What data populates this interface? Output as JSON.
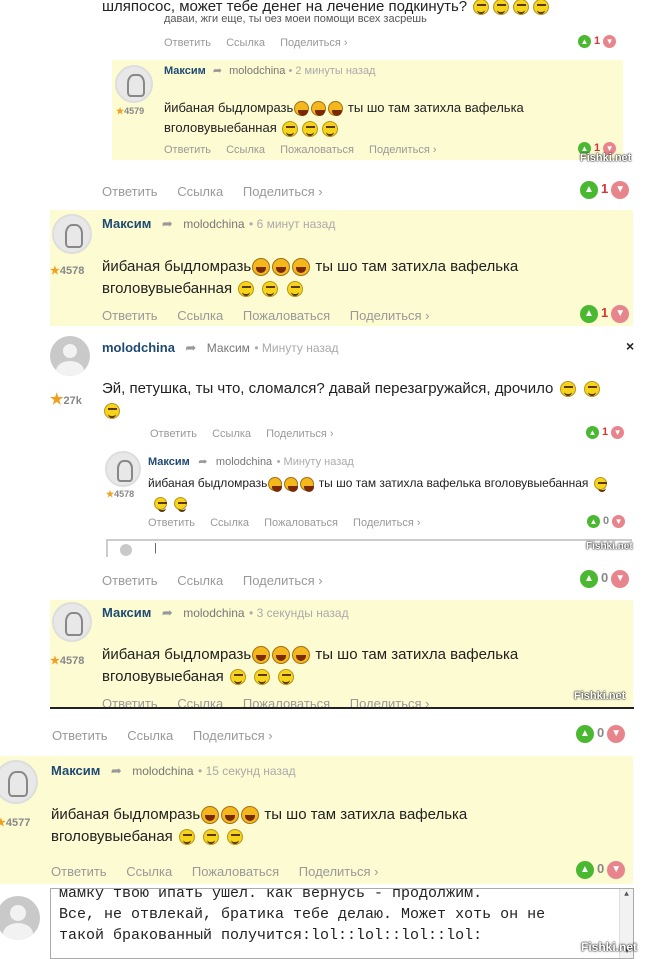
{
  "actions": {
    "reply": "Ответить",
    "link": "Ссылка",
    "share": "Поделиться ›",
    "complain": "Пожаловаться"
  },
  "watermark": "Fishki.net",
  "top": {
    "text_line1": "шляпосос, может тебе денег на лечение подкинуть?",
    "text_line2": "давай, жги ещё, ты без моей помощи всех засрёшь",
    "votes": "1"
  },
  "c1": {
    "author": "Максим",
    "reply_to": "molodchina",
    "time": "• 2 минуты назад",
    "rating": "4579",
    "text1": "йибаная быдломразь",
    "text2": "ты шо там затихла вафелька",
    "text3": "вголовувыебанная",
    "votes": "1"
  },
  "c1_outer_votes": "1",
  "c2": {
    "author": "Максим",
    "reply_to": "molodchina",
    "time": "• 6 минут назад",
    "rating": "4578",
    "text1": "йибаная быдломразь",
    "text2": "ты шо там затихла вафелька",
    "text3": "вголовувыебанная",
    "votes": "1"
  },
  "c3": {
    "author": "molodchina",
    "reply_to": "Максим",
    "time": "• Минуту назад",
    "rating": "27k",
    "text": "Эй, петушка, ты что, сломался? давай перезагружайся, дрочило",
    "votes": "1",
    "close": "×"
  },
  "c4": {
    "author": "Максим",
    "reply_to": "molodchina",
    "time": "• Минуту назад",
    "rating": "4578",
    "text1": "йибаная быдломразь",
    "text2": "ты шо там затихла вафелька вголовувыебанная",
    "votes": "0",
    "input_value": "|"
  },
  "c4_outer_votes": "0",
  "c5": {
    "author": "Максим",
    "reply_to": "molodchina",
    "time": "• 3 секунды назад",
    "rating": "4578",
    "text1": "йибаная быдломразь",
    "text2": "ты шо там затихла вафелька",
    "text3": "вголовувыебаная",
    "votes": "0"
  },
  "c6": {
    "author": "Максим",
    "reply_to": "molodchina",
    "time": "• 15 секунд назад",
    "rating": "4577",
    "text1": "йибаная быдломразь",
    "text2": "ты шо там затихла вафелька",
    "text3": "вголовувыебаная",
    "votes": "0"
  },
  "reply_box": {
    "line1": "мамку твою ипать ушел. как вернусь - продолжим.",
    "line2": "Все, не отвлекай, братика тебе делаю. Может хоть он не",
    "line3": "такой бракованный получится:lol::lol::lol::lol:"
  }
}
